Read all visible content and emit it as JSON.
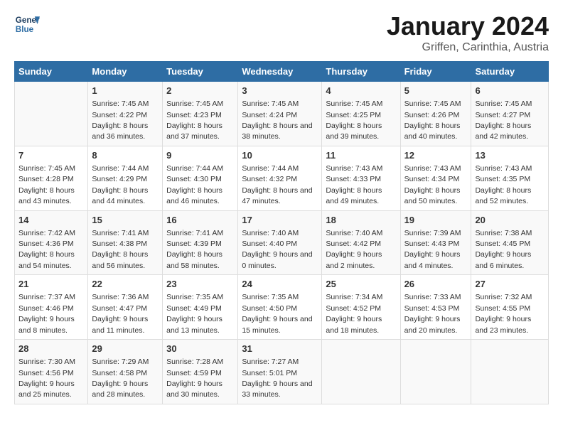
{
  "logo": {
    "line1": "General",
    "line2": "Blue"
  },
  "title": "January 2024",
  "subtitle": "Griffen, Carinthia, Austria",
  "headers": [
    "Sunday",
    "Monday",
    "Tuesday",
    "Wednesday",
    "Thursday",
    "Friday",
    "Saturday"
  ],
  "weeks": [
    [
      {
        "day": "",
        "sunrise": "",
        "sunset": "",
        "daylight": ""
      },
      {
        "day": "1",
        "sunrise": "Sunrise: 7:45 AM",
        "sunset": "Sunset: 4:22 PM",
        "daylight": "Daylight: 8 hours and 36 minutes."
      },
      {
        "day": "2",
        "sunrise": "Sunrise: 7:45 AM",
        "sunset": "Sunset: 4:23 PM",
        "daylight": "Daylight: 8 hours and 37 minutes."
      },
      {
        "day": "3",
        "sunrise": "Sunrise: 7:45 AM",
        "sunset": "Sunset: 4:24 PM",
        "daylight": "Daylight: 8 hours and 38 minutes."
      },
      {
        "day": "4",
        "sunrise": "Sunrise: 7:45 AM",
        "sunset": "Sunset: 4:25 PM",
        "daylight": "Daylight: 8 hours and 39 minutes."
      },
      {
        "day": "5",
        "sunrise": "Sunrise: 7:45 AM",
        "sunset": "Sunset: 4:26 PM",
        "daylight": "Daylight: 8 hours and 40 minutes."
      },
      {
        "day": "6",
        "sunrise": "Sunrise: 7:45 AM",
        "sunset": "Sunset: 4:27 PM",
        "daylight": "Daylight: 8 hours and 42 minutes."
      }
    ],
    [
      {
        "day": "7",
        "sunrise": "Sunrise: 7:45 AM",
        "sunset": "Sunset: 4:28 PM",
        "daylight": "Daylight: 8 hours and 43 minutes."
      },
      {
        "day": "8",
        "sunrise": "Sunrise: 7:44 AM",
        "sunset": "Sunset: 4:29 PM",
        "daylight": "Daylight: 8 hours and 44 minutes."
      },
      {
        "day": "9",
        "sunrise": "Sunrise: 7:44 AM",
        "sunset": "Sunset: 4:30 PM",
        "daylight": "Daylight: 8 hours and 46 minutes."
      },
      {
        "day": "10",
        "sunrise": "Sunrise: 7:44 AM",
        "sunset": "Sunset: 4:32 PM",
        "daylight": "Daylight: 8 hours and 47 minutes."
      },
      {
        "day": "11",
        "sunrise": "Sunrise: 7:43 AM",
        "sunset": "Sunset: 4:33 PM",
        "daylight": "Daylight: 8 hours and 49 minutes."
      },
      {
        "day": "12",
        "sunrise": "Sunrise: 7:43 AM",
        "sunset": "Sunset: 4:34 PM",
        "daylight": "Daylight: 8 hours and 50 minutes."
      },
      {
        "day": "13",
        "sunrise": "Sunrise: 7:43 AM",
        "sunset": "Sunset: 4:35 PM",
        "daylight": "Daylight: 8 hours and 52 minutes."
      }
    ],
    [
      {
        "day": "14",
        "sunrise": "Sunrise: 7:42 AM",
        "sunset": "Sunset: 4:36 PM",
        "daylight": "Daylight: 8 hours and 54 minutes."
      },
      {
        "day": "15",
        "sunrise": "Sunrise: 7:41 AM",
        "sunset": "Sunset: 4:38 PM",
        "daylight": "Daylight: 8 hours and 56 minutes."
      },
      {
        "day": "16",
        "sunrise": "Sunrise: 7:41 AM",
        "sunset": "Sunset: 4:39 PM",
        "daylight": "Daylight: 8 hours and 58 minutes."
      },
      {
        "day": "17",
        "sunrise": "Sunrise: 7:40 AM",
        "sunset": "Sunset: 4:40 PM",
        "daylight": "Daylight: 9 hours and 0 minutes."
      },
      {
        "day": "18",
        "sunrise": "Sunrise: 7:40 AM",
        "sunset": "Sunset: 4:42 PM",
        "daylight": "Daylight: 9 hours and 2 minutes."
      },
      {
        "day": "19",
        "sunrise": "Sunrise: 7:39 AM",
        "sunset": "Sunset: 4:43 PM",
        "daylight": "Daylight: 9 hours and 4 minutes."
      },
      {
        "day": "20",
        "sunrise": "Sunrise: 7:38 AM",
        "sunset": "Sunset: 4:45 PM",
        "daylight": "Daylight: 9 hours and 6 minutes."
      }
    ],
    [
      {
        "day": "21",
        "sunrise": "Sunrise: 7:37 AM",
        "sunset": "Sunset: 4:46 PM",
        "daylight": "Daylight: 9 hours and 8 minutes."
      },
      {
        "day": "22",
        "sunrise": "Sunrise: 7:36 AM",
        "sunset": "Sunset: 4:47 PM",
        "daylight": "Daylight: 9 hours and 11 minutes."
      },
      {
        "day": "23",
        "sunrise": "Sunrise: 7:35 AM",
        "sunset": "Sunset: 4:49 PM",
        "daylight": "Daylight: 9 hours and 13 minutes."
      },
      {
        "day": "24",
        "sunrise": "Sunrise: 7:35 AM",
        "sunset": "Sunset: 4:50 PM",
        "daylight": "Daylight: 9 hours and 15 minutes."
      },
      {
        "day": "25",
        "sunrise": "Sunrise: 7:34 AM",
        "sunset": "Sunset: 4:52 PM",
        "daylight": "Daylight: 9 hours and 18 minutes."
      },
      {
        "day": "26",
        "sunrise": "Sunrise: 7:33 AM",
        "sunset": "Sunset: 4:53 PM",
        "daylight": "Daylight: 9 hours and 20 minutes."
      },
      {
        "day": "27",
        "sunrise": "Sunrise: 7:32 AM",
        "sunset": "Sunset: 4:55 PM",
        "daylight": "Daylight: 9 hours and 23 minutes."
      }
    ],
    [
      {
        "day": "28",
        "sunrise": "Sunrise: 7:30 AM",
        "sunset": "Sunset: 4:56 PM",
        "daylight": "Daylight: 9 hours and 25 minutes."
      },
      {
        "day": "29",
        "sunrise": "Sunrise: 7:29 AM",
        "sunset": "Sunset: 4:58 PM",
        "daylight": "Daylight: 9 hours and 28 minutes."
      },
      {
        "day": "30",
        "sunrise": "Sunrise: 7:28 AM",
        "sunset": "Sunset: 4:59 PM",
        "daylight": "Daylight: 9 hours and 30 minutes."
      },
      {
        "day": "31",
        "sunrise": "Sunrise: 7:27 AM",
        "sunset": "Sunset: 5:01 PM",
        "daylight": "Daylight: 9 hours and 33 minutes."
      },
      {
        "day": "",
        "sunrise": "",
        "sunset": "",
        "daylight": ""
      },
      {
        "day": "",
        "sunrise": "",
        "sunset": "",
        "daylight": ""
      },
      {
        "day": "",
        "sunrise": "",
        "sunset": "",
        "daylight": ""
      }
    ]
  ]
}
